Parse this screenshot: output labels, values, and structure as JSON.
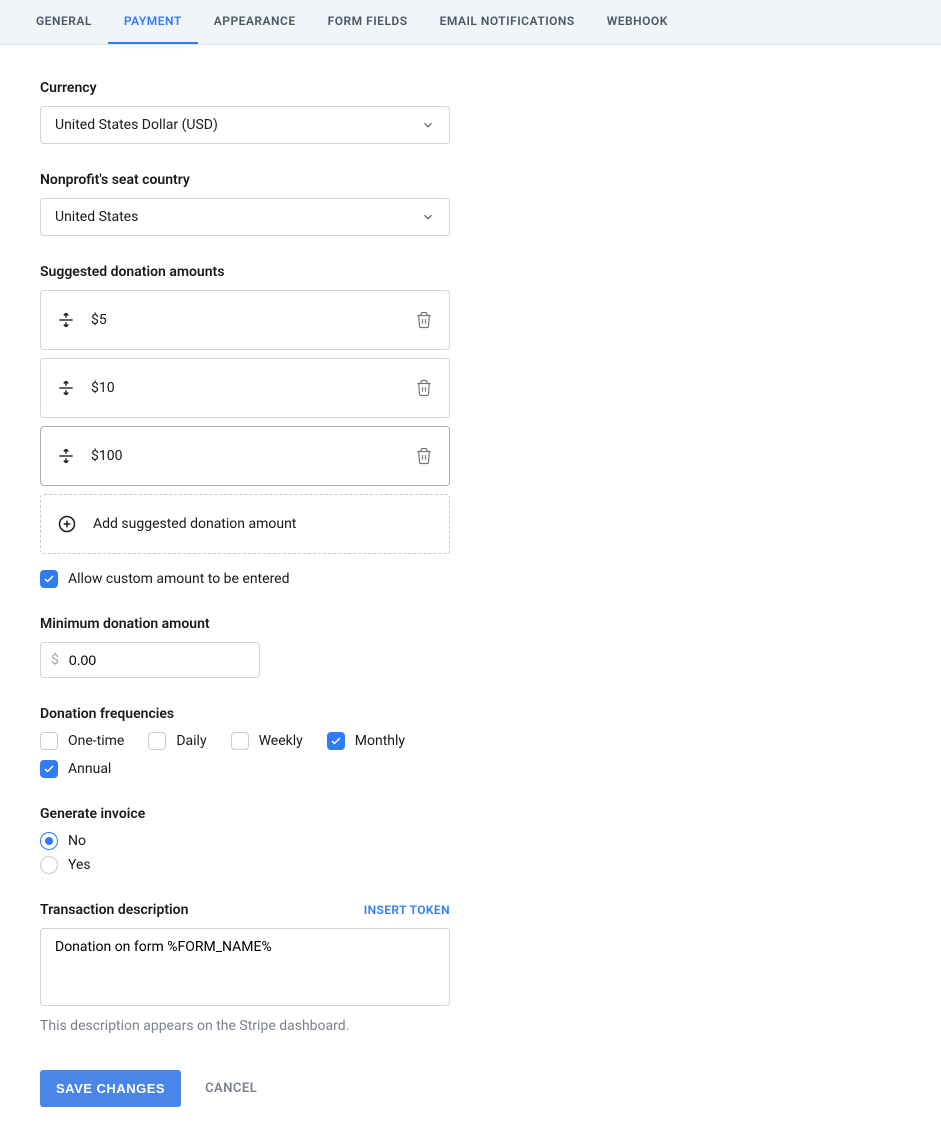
{
  "tabs": {
    "items": [
      {
        "label": "GENERAL"
      },
      {
        "label": "PAYMENT"
      },
      {
        "label": "APPEARANCE"
      },
      {
        "label": "FORM FIELDS"
      },
      {
        "label": "EMAIL NOTIFICATIONS"
      },
      {
        "label": "WEBHOOK"
      }
    ],
    "active_index": 1
  },
  "currency": {
    "label": "Currency",
    "value": "United States Dollar (USD)"
  },
  "seat_country": {
    "label": "Nonprofit's seat country",
    "value": "United States"
  },
  "suggested": {
    "label": "Suggested donation amounts",
    "items": [
      {
        "text": "$5"
      },
      {
        "text": "$10"
      },
      {
        "text": "$100"
      }
    ],
    "add_label": "Add suggested donation amount",
    "allow_custom_label": "Allow custom amount to be entered",
    "allow_custom_checked": true
  },
  "minimum": {
    "label": "Minimum donation amount",
    "prefix": "$",
    "value": "0.00"
  },
  "frequencies": {
    "label": "Donation frequencies",
    "items": [
      {
        "label": "One-time",
        "checked": false
      },
      {
        "label": "Daily",
        "checked": false
      },
      {
        "label": "Weekly",
        "checked": false
      },
      {
        "label": "Monthly",
        "checked": true
      },
      {
        "label": "Annual",
        "checked": true
      }
    ]
  },
  "invoice": {
    "label": "Generate invoice",
    "options": [
      {
        "label": "No",
        "checked": true
      },
      {
        "label": "Yes",
        "checked": false
      }
    ]
  },
  "description": {
    "label": "Transaction description",
    "insert_token_label": "INSERT TOKEN",
    "value": "Donation on form %FORM_NAME%",
    "help": "This description appears on the Stripe dashboard."
  },
  "actions": {
    "save": "SAVE CHANGES",
    "cancel": "CANCEL"
  }
}
